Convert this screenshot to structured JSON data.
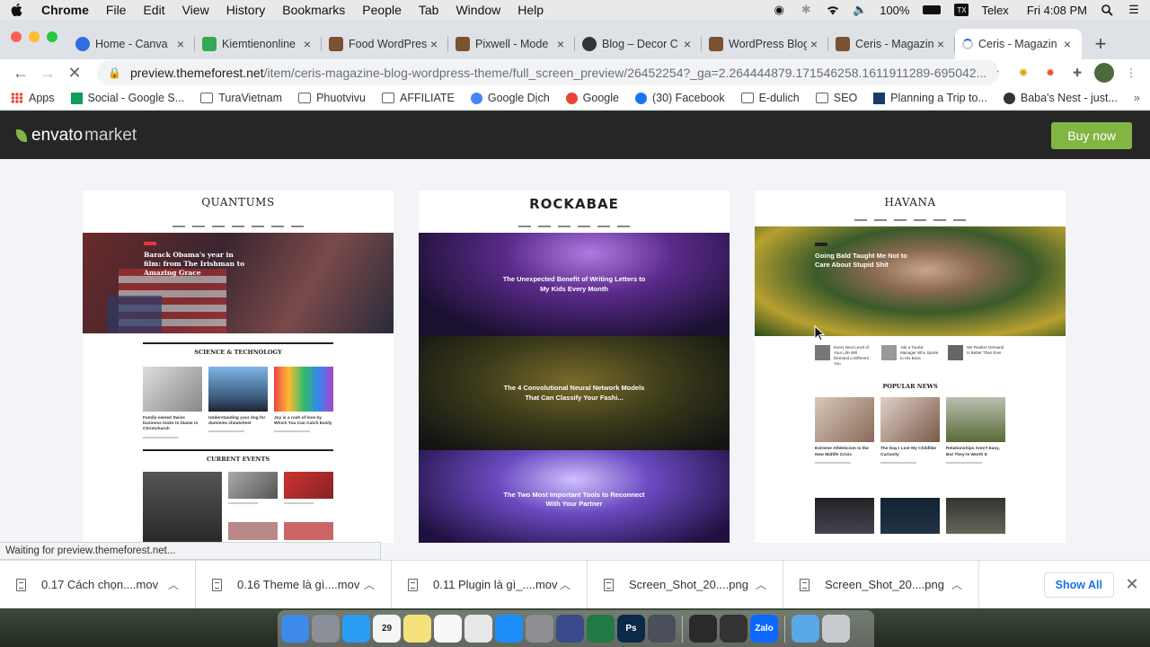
{
  "menubar": {
    "app_name": "Chrome",
    "items": [
      "File",
      "Edit",
      "View",
      "History",
      "Bookmarks",
      "People",
      "Tab",
      "Window",
      "Help"
    ],
    "battery": "100%",
    "input_method": "Telex",
    "clock": "Fri 4:08 PM"
  },
  "tabs": [
    {
      "label": "Home - Canva",
      "color": "#2f6fde",
      "icon": "canva-icon"
    },
    {
      "label": "Kiemtienonline",
      "color": "#34a853",
      "icon": "drive-icon"
    },
    {
      "label": "Food WordPress",
      "color": "#7a5230",
      "icon": "themeforest-icon"
    },
    {
      "label": "Pixwell - Mode",
      "color": "#7a5230",
      "icon": "themeforest-icon"
    },
    {
      "label": "Blog – Decor C",
      "color": "#333333",
      "icon": "shield-icon"
    },
    {
      "label": "WordPress Blog",
      "color": "#7a5230",
      "icon": "themeforest-icon"
    },
    {
      "label": "Ceris - Magazin",
      "color": "#7a5230",
      "icon": "themeforest-icon"
    },
    {
      "label": "Ceris - Magazin",
      "color": "#cccccc",
      "icon": "loading-icon"
    }
  ],
  "address": {
    "host": "preview.themeforest.net",
    "path": "/item/ceris-magazine-blog-wordpress-theme/full_screen_preview/26452254?_ga=2.264444879.171546258.1611911289-695042..."
  },
  "bookmarks": [
    {
      "label": "Apps",
      "type": "grid"
    },
    {
      "label": "Social - Google S...",
      "type": "sheet"
    },
    {
      "label": "TuraVietnam",
      "type": "folder"
    },
    {
      "label": "Phuotvivu",
      "type": "folder"
    },
    {
      "label": "AFFILIATE",
      "type": "folder"
    },
    {
      "label": "Google Dịch",
      "type": "translate"
    },
    {
      "label": "Google",
      "type": "google"
    },
    {
      "label": "(30) Facebook",
      "type": "facebook"
    },
    {
      "label": "E-dulich",
      "type": "folder"
    },
    {
      "label": "SEO",
      "type": "folder"
    },
    {
      "label": "Planning a Trip to...",
      "type": "site"
    },
    {
      "label": "Baba's Nest - just...",
      "type": "tripadvisor"
    }
  ],
  "envato": {
    "logo_left": "envato",
    "logo_right": "market",
    "buy_label": "Buy now",
    "accent": "#82b541"
  },
  "demos": [
    {
      "logo": "QUANTUMS",
      "hero_headline": "Barack Obama's year in film: from The Irishman to Amazing Grace",
      "section_1": "SCIENCE & TECHNOLOGY",
      "captions": [
        "Family-owned Swiss business looks to blame in Christchurch",
        "Understanding your dog for dummies cheatsheet",
        "Joy is a rush of love by Which You Can Catch Easily"
      ],
      "section_2": "CURRENT EVENTS"
    },
    {
      "logo": "ROCKABAE",
      "blocks": [
        "The Unexpected Benefit of Writing Letters to My Kids Every Month",
        "The 4 Convolutional Neural Network Models That Can Classify Your Fashi...",
        "The Two Most Important Tools to Reconnect With Your Partner"
      ]
    },
    {
      "logo": "HAVANA",
      "hero_headline": "Going Bald Taught Me Not to Care About Stupid Shit",
      "section": "POPULAR NEWS",
      "small_items": [
        "Every Next Level of Your Life Will Demand a Different You",
        "Ask a Tourist Manager Who Spoke to His Boss",
        "We Realize Demand Is Better Than Ever"
      ],
      "captions": [
        "Extreme Athleticism Is the New Midlife Crisis",
        "The Day I Lost My Childlike Curiosity",
        "Relationships Aren't Easy, But They're Worth It"
      ]
    }
  ],
  "status": "Waiting for preview.themeforest.net...",
  "downloads": [
    {
      "name": "0.17 Cách chọn....mov"
    },
    {
      "name": "0.16 Theme là gì....mov"
    },
    {
      "name": "0.11 Plugin là gì_....mov"
    },
    {
      "name": "Screen_Shot_20....png"
    },
    {
      "name": "Screen_Shot_20....png"
    }
  ],
  "show_all": "Show All",
  "dock": [
    {
      "name": "finder-icon",
      "color": "#3d8ae8"
    },
    {
      "name": "launchpad-icon",
      "color": "#8a8f98"
    },
    {
      "name": "safari-icon",
      "color": "#2a9df4"
    },
    {
      "name": "calendar-icon",
      "color": "#f5f5f5",
      "text": "29"
    },
    {
      "name": "notes-icon",
      "color": "#f6e27a"
    },
    {
      "name": "music-icon",
      "color": "#f8f8f8"
    },
    {
      "name": "chrome-icon",
      "color": "#e8e8e8"
    },
    {
      "name": "app-store-icon",
      "color": "#1c8ef9"
    },
    {
      "name": "system-preferences-icon",
      "color": "#8e8e93"
    },
    {
      "name": "sublime-icon",
      "color": "#3a4a8a"
    },
    {
      "name": "excel-icon",
      "color": "#1f7a44"
    },
    {
      "name": "photoshop-icon",
      "color": "#0b2a4a",
      "text": "Ps"
    },
    {
      "name": "quicktime-icon",
      "color": "#4a4f5a"
    },
    {
      "name": "activity-monitor-icon",
      "color": "#2a2a2a"
    },
    {
      "name": "piano-icon",
      "color": "#333333"
    },
    {
      "name": "zalo-icon",
      "color": "#0a68ff",
      "text": "Zalo"
    },
    {
      "name": "folder-icon",
      "color": "#5aa9e6"
    },
    {
      "name": "trash-icon",
      "color": "#c8ccd1"
    }
  ]
}
